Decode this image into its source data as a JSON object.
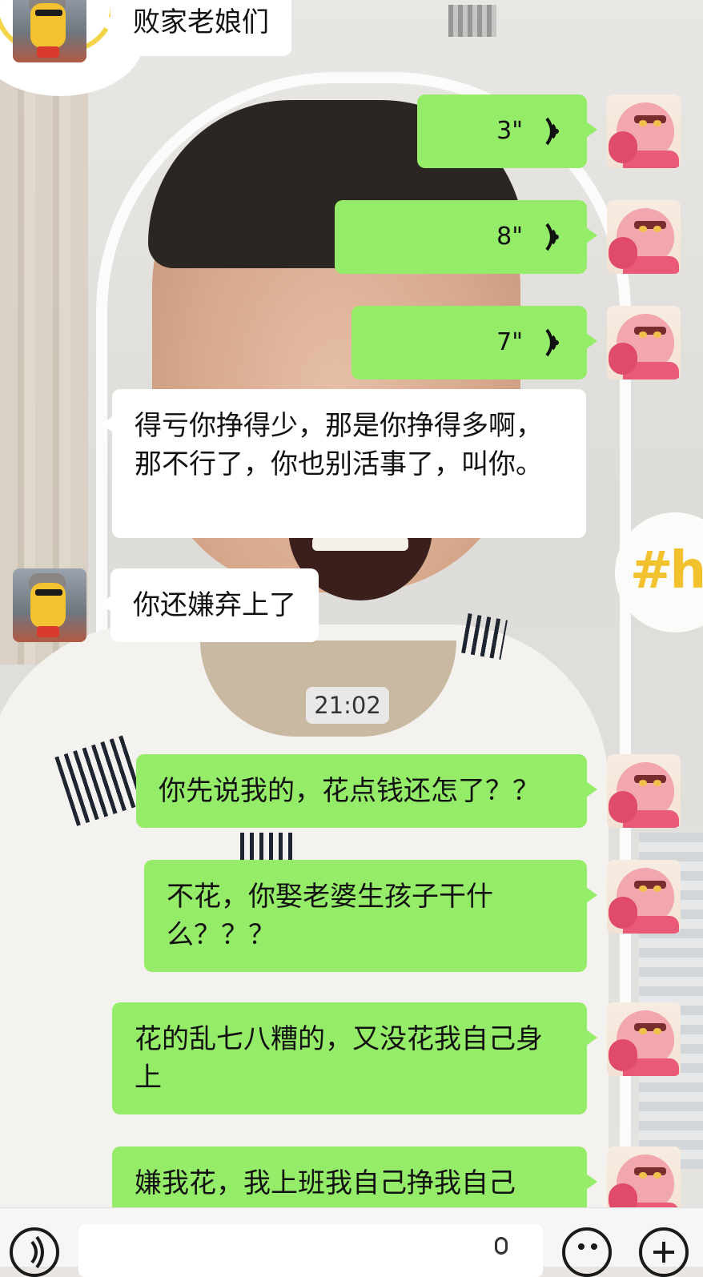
{
  "chat": {
    "messages": [
      {
        "sender": "other",
        "type": "text",
        "text": "败家老娘们"
      },
      {
        "sender": "me",
        "type": "voice",
        "duration": "3\""
      },
      {
        "sender": "me",
        "type": "voice",
        "duration": "8\""
      },
      {
        "sender": "me",
        "type": "voice",
        "duration": "7\""
      },
      {
        "sender": "other",
        "type": "text",
        "text": "得亏你挣得少，那是你挣得多啊，那不行了，你也别活事了，叫你。"
      },
      {
        "sender": "other",
        "type": "text",
        "text": "你还嫌弃上了"
      },
      {
        "sender": "me",
        "type": "text",
        "text": "你先说我的，花点钱还怎了？？"
      },
      {
        "sender": "me",
        "type": "text",
        "text": "不花，你娶老婆生孩子干什么？？？"
      },
      {
        "sender": "me",
        "type": "text",
        "text": "花的乱七八糟的，又没花我自己身上"
      },
      {
        "sender": "me",
        "type": "text",
        "text": "嫌我花，我上班我自己挣我自己"
      }
    ],
    "timestamp": "21:02"
  },
  "background": {
    "sticker_text": "#h"
  },
  "icons": {
    "voice_toggle": "voice-toggle-icon",
    "emoji": "emoji-icon",
    "plus": "plus-icon",
    "voice_wave": "voice-wave-icon"
  },
  "colors": {
    "bubble_me": "#95ec69",
    "bubble_other": "#ffffff",
    "timestamp_bg": "#ececec"
  }
}
